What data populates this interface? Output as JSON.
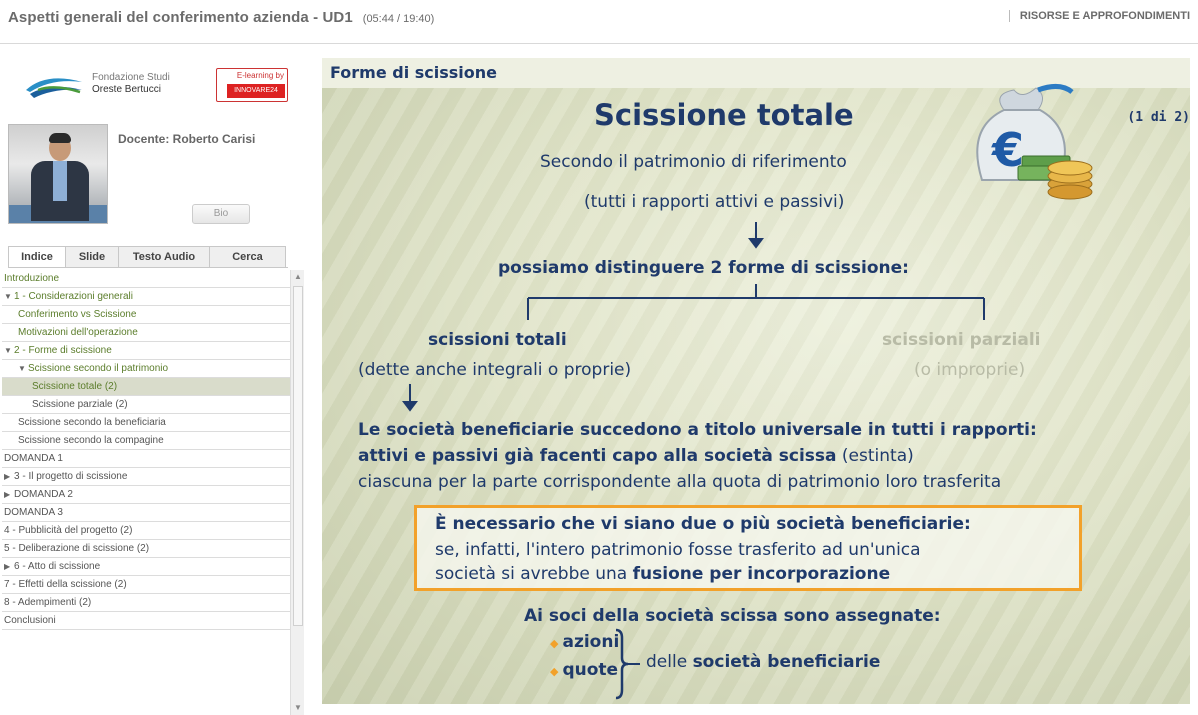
{
  "header": {
    "title": "Aspetti generali del conferimento azienda - UD1",
    "time": "(05:44 / 19:40)",
    "resources_label": "RISORSE E APPROFONDIMENTI"
  },
  "branding": {
    "foundation_line1": "Fondazione Studi",
    "foundation_line2": "Oreste Bertucci",
    "elearning_line1": "E-learning by",
    "elearning_line2": "INNOVARE24"
  },
  "teacher": {
    "label": "Docente: Roberto Carisi",
    "bio_button": "Bio"
  },
  "tabs": [
    {
      "label": "Indice"
    },
    {
      "label": "Slide"
    },
    {
      "label": "Testo Audio"
    },
    {
      "label": "Cerca"
    }
  ],
  "index": [
    {
      "label": "Introduzione",
      "indent": 0,
      "arrow": "",
      "style": "green"
    },
    {
      "label": "1 - Considerazioni generali",
      "indent": 0,
      "arrow": "▼",
      "style": "green"
    },
    {
      "label": "Conferimento vs Scissione",
      "indent": 1,
      "arrow": "",
      "style": "green"
    },
    {
      "label": "Motivazioni dell'operazione",
      "indent": 1,
      "arrow": "",
      "style": "green"
    },
    {
      "label": "2 - Forme di scissione",
      "indent": 0,
      "arrow": "▼",
      "style": "green"
    },
    {
      "label": "Scissione secondo il patrimonio",
      "indent": 1,
      "arrow": "▼",
      "style": "green"
    },
    {
      "label": "Scissione totale (2)",
      "indent": 2,
      "arrow": "",
      "style": "green active"
    },
    {
      "label": "Scissione parziale (2)",
      "indent": 2,
      "arrow": "",
      "style": ""
    },
    {
      "label": "Scissione secondo la beneficiaria",
      "indent": 1,
      "arrow": "",
      "style": ""
    },
    {
      "label": "Scissione secondo la compagine",
      "indent": 1,
      "arrow": "",
      "style": ""
    },
    {
      "label": "DOMANDA 1",
      "indent": 0,
      "arrow": "",
      "style": ""
    },
    {
      "label": "3 - Il progetto di scissione",
      "indent": 0,
      "arrow": "▶",
      "style": ""
    },
    {
      "label": "DOMANDA 2",
      "indent": 0,
      "arrow": "▶",
      "style": ""
    },
    {
      "label": "DOMANDA 3",
      "indent": 0,
      "arrow": "",
      "style": ""
    },
    {
      "label": "4 - Pubblicità del progetto (2)",
      "indent": 0,
      "arrow": "",
      "style": ""
    },
    {
      "label": "5 - Deliberazione di scissione (2)",
      "indent": 0,
      "arrow": "",
      "style": ""
    },
    {
      "label": "6 - Atto di scissione",
      "indent": 0,
      "arrow": "▶",
      "style": ""
    },
    {
      "label": "7 - Effetti della scissione (2)",
      "indent": 0,
      "arrow": "",
      "style": ""
    },
    {
      "label": "8 - Adempimenti (2)",
      "indent": 0,
      "arrow": "",
      "style": ""
    },
    {
      "label": "Conclusioni",
      "indent": 0,
      "arrow": "",
      "style": ""
    }
  ],
  "slide": {
    "section": "Forme di scissione",
    "title": "Scissione totale",
    "page": "(1 di 2)",
    "line1": "Secondo il patrimonio di riferimento",
    "line2": "(tutti i rapporti attivi e passivi)",
    "distinguish": "possiamo distinguere 2 forme di scissione:",
    "left_head": "scissioni totali",
    "left_sub": "(dette anche integrali o proprie)",
    "right_head": "scissioni parziali",
    "right_sub": "(o improprie)",
    "p1": "Le società beneficiarie succedono a titolo universale in tutti i rapporti:",
    "p2_bold": "attivi e passivi già facenti capo alla società scissa",
    "p2_rest": " (estinta)",
    "p3": "ciascuna per la parte corrispondente alla quota di patrimonio loro trasferita",
    "box_l1": "È necessario che vi siano due o più società beneficiarie:",
    "box_l2": "se, infatti, l'intero patrimonio fosse trasferito ad un'unica",
    "box_l3_pre": "società si avrebbe una ",
    "box_l3_bold": "fusione per incorporazione",
    "assign": "Ai soci della società scissa sono assegnate:",
    "bullet1": "azioni",
    "bullet2": "quote",
    "delle": "delle ",
    "delle_bold": "società beneficiarie"
  },
  "colors": {
    "accent_blue": "#1f3a6b",
    "box_orange": "#f2a12a",
    "index_green": "#5b7d2b"
  },
  "icons": [
    "moneybag-euro-icon",
    "coins-icon",
    "fondazione-logo-icon"
  ]
}
